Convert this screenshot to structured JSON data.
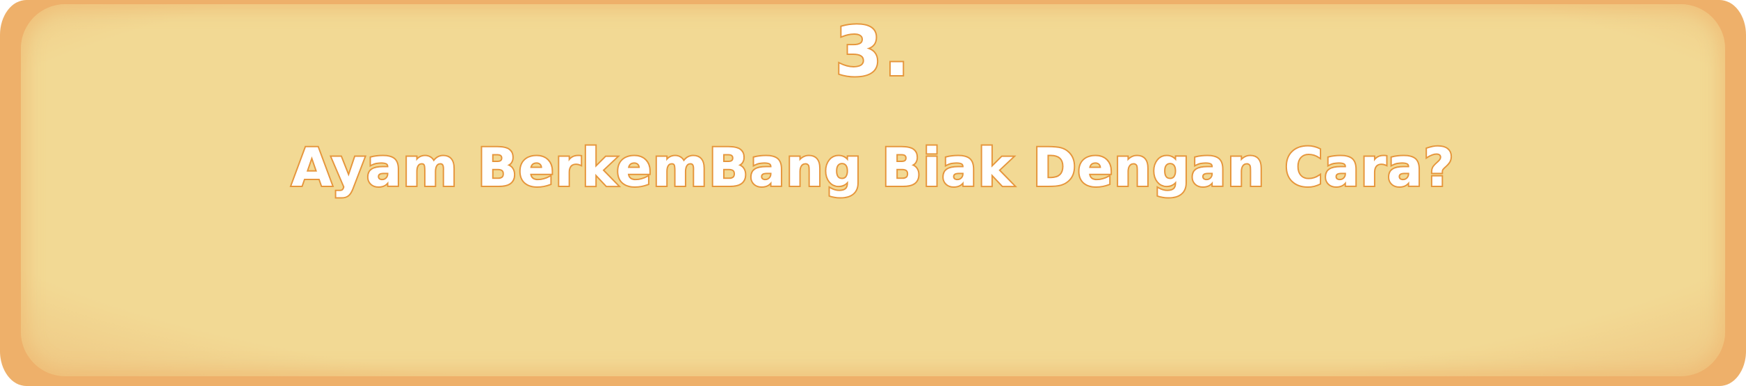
{
  "question_card": {
    "number": "3.",
    "question": "Ayam BerkemBang Biak Dengan Cara?",
    "colors": {
      "frame": "#eeb06a",
      "panel": "#f2d994",
      "text_fill": "#ffffff",
      "text_outline": "#e6963c"
    }
  }
}
